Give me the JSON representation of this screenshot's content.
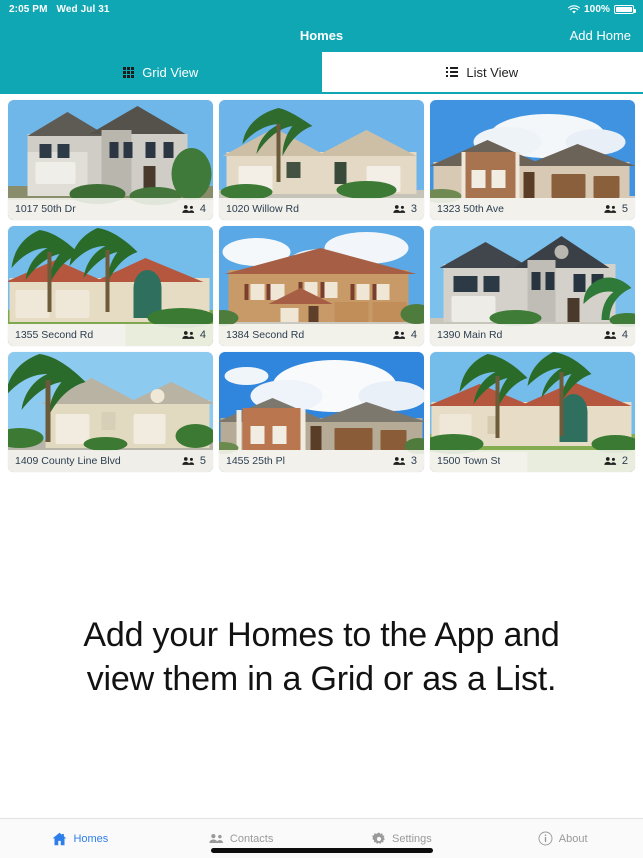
{
  "status_bar": {
    "time": "2:05 PM",
    "date": "Wed Jul 31",
    "battery_percent": "100%",
    "wifi_icon": "wifi-icon",
    "battery_icon": "battery-icon"
  },
  "nav": {
    "title": "Homes",
    "action_label": "Add Home"
  },
  "segmented_control": {
    "tabs": [
      {
        "label": "Grid View",
        "icon": "grid-icon",
        "active": true
      },
      {
        "label": "List View",
        "icon": "list-icon",
        "active": false
      }
    ]
  },
  "homes": [
    {
      "address": "1017 50th Dr",
      "occupants": "4",
      "occupants_icon": "people-icon"
    },
    {
      "address": "1020 Willow Rd",
      "occupants": "3",
      "occupants_icon": "people-icon"
    },
    {
      "address": "1323 50th Ave",
      "occupants": "5",
      "occupants_icon": "people-icon"
    },
    {
      "address": "1355 Second Rd",
      "occupants": "4",
      "occupants_icon": "people-icon"
    },
    {
      "address": "1384 Second Rd",
      "occupants": "4",
      "occupants_icon": "people-icon"
    },
    {
      "address": "1390 Main Rd",
      "occupants": "4",
      "occupants_icon": "people-icon"
    },
    {
      "address": "1409 County Line Blvd",
      "occupants": "5",
      "occupants_icon": "people-icon"
    },
    {
      "address": "1455 25th Pl",
      "occupants": "3",
      "occupants_icon": "people-icon"
    },
    {
      "address": "1500 Town St",
      "occupants": "2",
      "occupants_icon": "people-icon"
    }
  ],
  "hint": {
    "line1": "Add your Homes to the App and",
    "line2": "view them in a Grid or as a List."
  },
  "bottom_tabs": [
    {
      "label": "Homes",
      "icon": "home-icon",
      "active": true
    },
    {
      "label": "Contacts",
      "icon": "contacts-icon",
      "active": false
    },
    {
      "label": "Settings",
      "icon": "gear-icon",
      "active": false
    },
    {
      "label": "About",
      "icon": "info-icon",
      "active": false
    }
  ],
  "colors": {
    "accent_teal": "#10A7B4",
    "active_tab_blue": "#2F7FEA",
    "inactive_gray": "#9A9A9A",
    "card_footer": "#F7F6F0"
  }
}
